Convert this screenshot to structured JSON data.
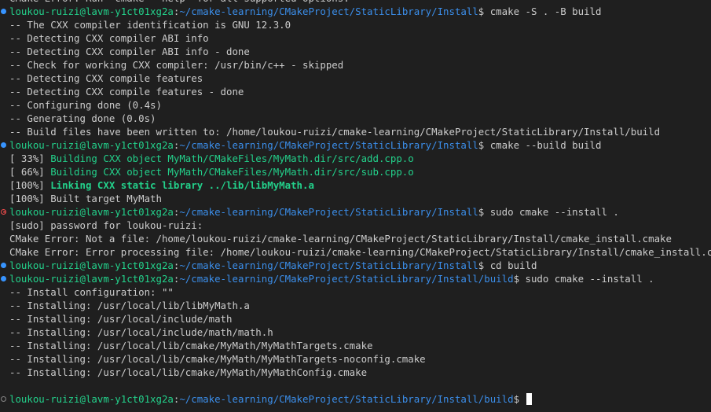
{
  "prompt": {
    "user_host": "loukou-ruizi@lavm-y1ct01xg2a",
    "sep": ":",
    "dollar": "$"
  },
  "lines": [
    {
      "kind": "text",
      "text": "CMake Error: Run 'cmake --help' for all supported options."
    },
    {
      "kind": "prompt",
      "status": "ok",
      "path": "~/cmake-learning/CMakeProject/StaticLibrary/Install",
      "cmd": " cmake -S . -B build"
    },
    {
      "kind": "text",
      "text": "-- The CXX compiler identification is GNU 12.3.0"
    },
    {
      "kind": "text",
      "text": "-- Detecting CXX compiler ABI info"
    },
    {
      "kind": "text",
      "text": "-- Detecting CXX compiler ABI info - done"
    },
    {
      "kind": "text",
      "text": "-- Check for working CXX compiler: /usr/bin/c++ - skipped"
    },
    {
      "kind": "text",
      "text": "-- Detecting CXX compile features"
    },
    {
      "kind": "text",
      "text": "-- Detecting CXX compile features - done"
    },
    {
      "kind": "text",
      "text": "-- Configuring done (0.4s)"
    },
    {
      "kind": "text",
      "text": "-- Generating done (0.0s)"
    },
    {
      "kind": "text",
      "text": "-- Build files have been written to: /home/loukou-ruizi/cmake-learning/CMakeProject/StaticLibrary/Install/build"
    },
    {
      "kind": "prompt",
      "status": "ok",
      "path": "~/cmake-learning/CMakeProject/StaticLibrary/Install",
      "cmd": " cmake --build build"
    },
    {
      "kind": "build",
      "prefix": "[ 33%] ",
      "text": "Building CXX object MyMath/CMakeFiles/MyMath.dir/src/add.cpp.o",
      "bold": false
    },
    {
      "kind": "build",
      "prefix": "[ 66%] ",
      "text": "Building CXX object MyMath/CMakeFiles/MyMath.dir/src/sub.cpp.o",
      "bold": false
    },
    {
      "kind": "build",
      "prefix": "[100%] ",
      "text": "Linking CXX static library ../lib/libMyMath.a",
      "bold": true
    },
    {
      "kind": "text",
      "text": "[100%] Built target MyMath"
    },
    {
      "kind": "prompt",
      "status": "err",
      "path": "~/cmake-learning/CMakeProject/StaticLibrary/Install",
      "cmd": " sudo cmake --install ."
    },
    {
      "kind": "text",
      "text": "[sudo] password for loukou-ruizi:"
    },
    {
      "kind": "text",
      "text": "CMake Error: Not a file: /home/loukou-ruizi/cmake-learning/CMakeProject/StaticLibrary/Install/cmake_install.cmake"
    },
    {
      "kind": "text",
      "text": "CMake Error: Error processing file: /home/loukou-ruizi/cmake-learning/CMakeProject/StaticLibrary/Install/cmake_install.cmake"
    },
    {
      "kind": "prompt",
      "status": "ok",
      "path": "~/cmake-learning/CMakeProject/StaticLibrary/Install",
      "cmd": " cd build"
    },
    {
      "kind": "prompt",
      "status": "ok",
      "path": "~/cmake-learning/CMakeProject/StaticLibrary/Install/build",
      "cmd": " sudo cmake --install ."
    },
    {
      "kind": "text",
      "text": "-- Install configuration: \"\""
    },
    {
      "kind": "text",
      "text": "-- Installing: /usr/local/lib/libMyMath.a"
    },
    {
      "kind": "text",
      "text": "-- Installing: /usr/local/include/math"
    },
    {
      "kind": "text",
      "text": "-- Installing: /usr/local/include/math/math.h"
    },
    {
      "kind": "text",
      "text": "-- Installing: /usr/local/lib/cmake/MyMath/MyMathTargets.cmake"
    },
    {
      "kind": "text",
      "text": "-- Installing: /usr/local/lib/cmake/MyMath/MyMathTargets-noconfig.cmake"
    },
    {
      "kind": "text",
      "text": "-- Installing: /usr/local/lib/cmake/MyMath/MyMathConfig.cmake"
    },
    {
      "kind": "blank",
      "text": ""
    },
    {
      "kind": "prompt",
      "status": "idle",
      "path": "~/cmake-learning/CMakeProject/StaticLibrary/Install/build",
      "cmd": " ",
      "cursor": true
    }
  ],
  "colors": {
    "background": "#1f1f1f",
    "foreground": "#cccccc",
    "user_host": "#23d18b",
    "path": "#3b8eea",
    "build_progress": "#23d18b",
    "status_ok": "#3794ff",
    "status_error": "#f14c4c"
  }
}
